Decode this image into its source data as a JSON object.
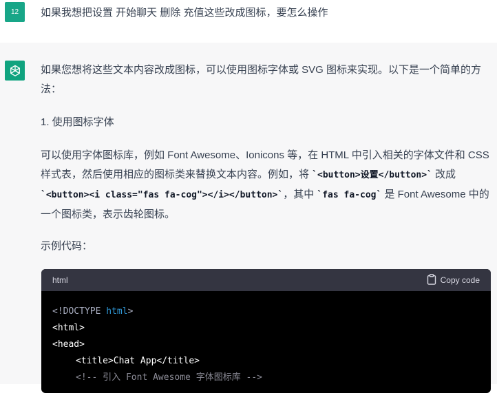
{
  "user": {
    "avatar_text": "12",
    "message": "如果我想把设置 开始聊天 删除 充值这些改成图标，要怎么操作"
  },
  "assistant": {
    "avatar_icon": "openai-logo-icon",
    "para1": "如果您想将这些文本内容改成图标，可以使用图标字体或 SVG 图标来实现。以下是一个简单的方法：",
    "list_item_1": "1. 使用图标字体",
    "para2_a": "可以使用字体图标库，例如 Font Awesome、Ionicons 等，在 HTML 中引入相关的字体文件和 CSS 样式表，然后使用相应的图标类来替换文本内容。例如，将 ",
    "para2_code1": "`<button>设置</button>`",
    "para2_b": " 改成 ",
    "para2_code2": "`<button><i class=\"fas fa-cog\"></i></button>`",
    "para2_c": "，其中 ",
    "para2_code3": "`fas fa-cog`",
    "para2_d": " 是 Font Awesome 中的一个图标类，表示齿轮图标。",
    "para3": "示例代码："
  },
  "code_block": {
    "language": "html",
    "copy_label": "Copy code",
    "copy_icon": "clipboard-icon",
    "lines": {
      "l1_open": "<!DOCTYPE ",
      "l1_kw": "html",
      "l1_close": ">",
      "l2": "<html>",
      "l3": "<head>",
      "l4": "<title>Chat App</title>",
      "l5": "<!-- 引入 Font Awesome 字体图标库 -->"
    }
  },
  "colors": {
    "user_avatar": "#18a688",
    "bot_avatar": "#10a37f",
    "assistant_bg": "#f7f7f8",
    "code_header_bg": "#343541",
    "code_bg": "#000000"
  }
}
